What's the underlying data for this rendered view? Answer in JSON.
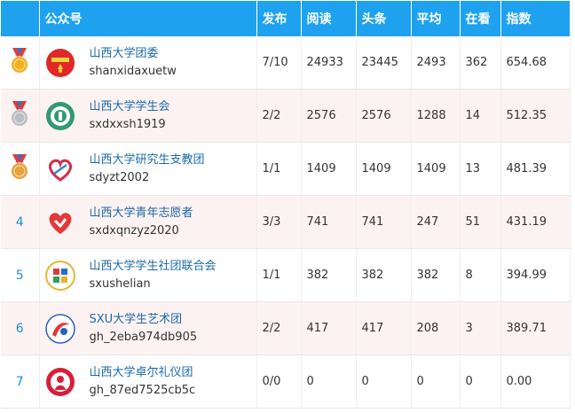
{
  "header": {
    "rank": "",
    "account": "公众号",
    "published": "发布",
    "reads": "阅读",
    "headline": "头条",
    "average": "平均",
    "watching": "在看",
    "index": "指数"
  },
  "colors": {
    "header_bg": "#1ea2f0",
    "alt_row_bg": "#fdf2f2",
    "link": "#1a8fd8",
    "gold": "#f2b01e",
    "silver": "#b9bec4",
    "bronze": "#e6a23c"
  },
  "rows": [
    {
      "rank": "1",
      "medal": "gold",
      "icon": "communist-youth-league-icon",
      "name": "山西大学团委",
      "id": "shanxidaxuetw",
      "published": "7/10",
      "reads": "24933",
      "headline": "23445",
      "average": "2493",
      "watching": "362",
      "index": "654.68"
    },
    {
      "rank": "2",
      "medal": "silver",
      "icon": "student-union-icon",
      "name": "山西大学学生会",
      "id": "sxdxxsh1919",
      "published": "2/2",
      "reads": "2576",
      "headline": "2576",
      "average": "1288",
      "watching": "14",
      "index": "512.35"
    },
    {
      "rank": "3",
      "medal": "bronze",
      "icon": "heart-ribbon-icon",
      "name": "山西大学研究生支教团",
      "id": "sdyzt2002",
      "published": "1/1",
      "reads": "1409",
      "headline": "1409",
      "average": "1409",
      "watching": "13",
      "index": "481.39"
    },
    {
      "rank": "4",
      "medal": "",
      "icon": "volunteer-heart-hand-icon",
      "name": "山西大学青年志愿者",
      "id": "sxdxqnzyz2020",
      "published": "3/3",
      "reads": "741",
      "headline": "741",
      "average": "247",
      "watching": "51",
      "index": "431.19"
    },
    {
      "rank": "5",
      "medal": "",
      "icon": "club-union-icon",
      "name": "山西大学学生社团联合会",
      "id": "sxushelian",
      "published": "1/1",
      "reads": "382",
      "headline": "382",
      "average": "382",
      "watching": "8",
      "index": "394.99"
    },
    {
      "rank": "6",
      "medal": "",
      "icon": "art-troupe-icon",
      "name": "SXU大学生艺术团",
      "id": "gh_2eba974db905",
      "published": "2/2",
      "reads": "417",
      "headline": "417",
      "average": "208",
      "watching": "3",
      "index": "389.71"
    },
    {
      "rank": "7",
      "medal": "",
      "icon": "etiquette-team-icon",
      "name": "山西大学卓尔礼仪团",
      "id": "gh_87ed7525cb5c",
      "published": "0/0",
      "reads": "0",
      "headline": "0",
      "average": "0",
      "watching": "0",
      "index": "0.00"
    }
  ]
}
